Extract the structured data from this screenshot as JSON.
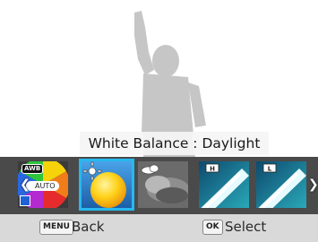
{
  "preview": {
    "title": "White Balance : Daylight"
  },
  "wb_options": [
    {
      "name": "auto-white-balance",
      "badge": "AWB",
      "label": "AUTO",
      "selected": false
    },
    {
      "name": "daylight",
      "selected": true
    },
    {
      "name": "cloudy",
      "selected": false
    },
    {
      "name": "fluorescent-h",
      "marker": "H",
      "selected": false
    },
    {
      "name": "fluorescent-l",
      "marker": "L",
      "selected": false
    }
  ],
  "nav": {
    "prev_icon": "chevron-left-icon",
    "next_icon": "chevron-right-icon"
  },
  "footer": {
    "menu_key": "MENU",
    "menu_label": "Back",
    "ok_key": "OK",
    "ok_label": "Select"
  },
  "colors": {
    "selection": "#27b8ef",
    "strip": "#4a4a4a",
    "footer": "#d9d9d9"
  }
}
